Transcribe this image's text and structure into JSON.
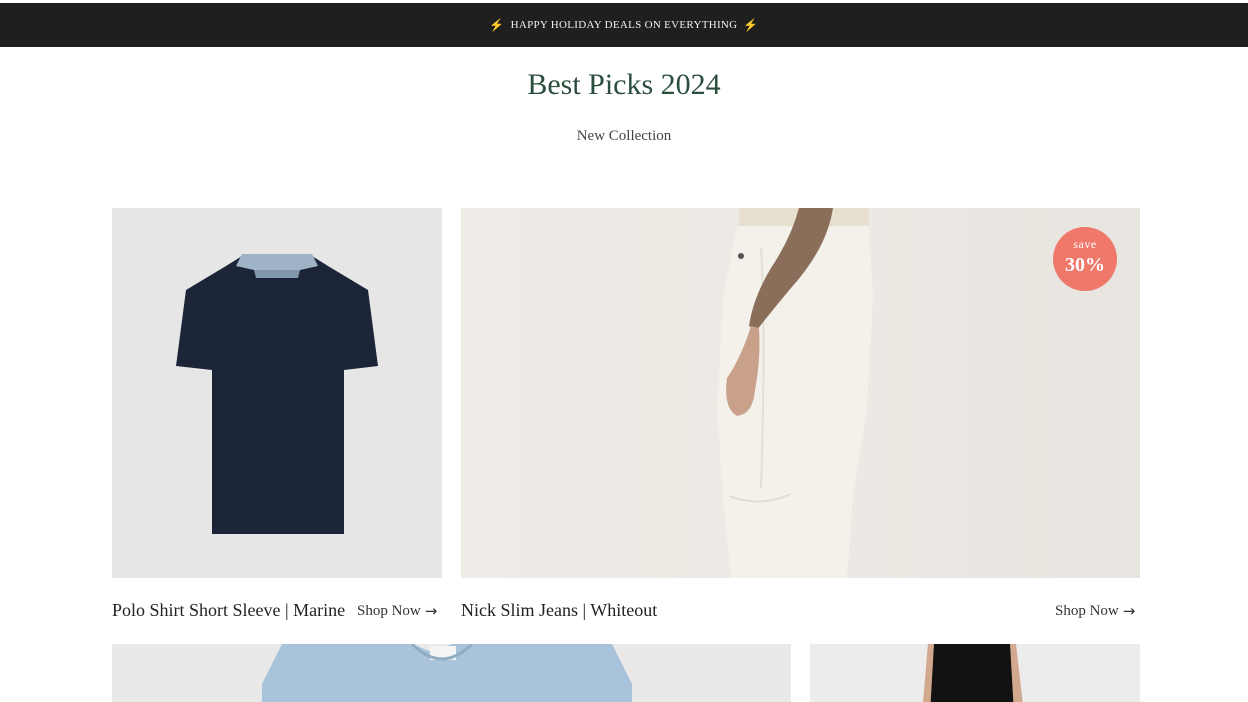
{
  "announcement": {
    "text": "HAPPY HOLIDAY DEALS ON EVERYTHING",
    "icon_left": "lightning-icon",
    "icon_right": "lightning-icon",
    "bolt_glyph": "⚡"
  },
  "section": {
    "title": "Best Picks 2024",
    "subtitle": "New Collection"
  },
  "products": [
    {
      "name": "Polo Shirt Short Sleeve | Marine",
      "cta": "Shop Now"
    },
    {
      "name": "Nick Slim Jeans | Whiteout",
      "cta": "Shop Now",
      "badge_top": "save",
      "badge_value": "30%"
    }
  ],
  "arrow_glyph": "→",
  "colors": {
    "announce_bg": "#1f1f1f",
    "title": "#2c4e3c",
    "badge": "#f0786b",
    "navy": "#1c2538",
    "collar": "#9fb3c6"
  }
}
